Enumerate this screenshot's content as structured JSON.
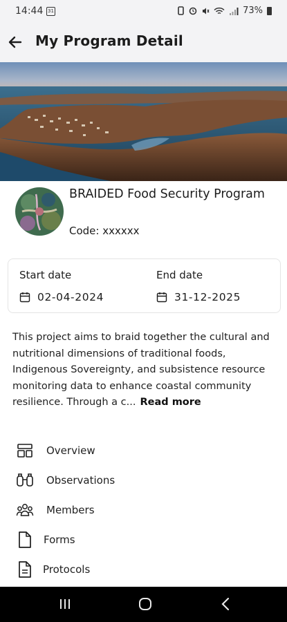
{
  "status": {
    "time": "14:44",
    "calendar_badge": "31",
    "battery": "73%"
  },
  "header": {
    "title": "My Program Detail",
    "back_icon": "arrow-left-icon"
  },
  "program": {
    "name": "BRAIDED Food Security Program",
    "code_label": "Code: xxxxxx"
  },
  "dates": {
    "start_label": "Start date",
    "start_value": "02-04-2024",
    "end_label": "End date",
    "end_value": "31-12-2025",
    "icon": "calendar-icon"
  },
  "description": {
    "text": "This project aims to braid together the cultural and nutritional dimensions of traditional foods, Indigenous Sovereignty, and subsistence resource monitoring data to enhance coastal community resilience. Through a c...",
    "read_more": "Read more"
  },
  "menu": {
    "items": [
      {
        "label": "Overview",
        "icon": "overview-icon"
      },
      {
        "label": "Observations",
        "icon": "binoculars-icon"
      },
      {
        "label": "Members",
        "icon": "members-icon"
      },
      {
        "label": "Forms",
        "icon": "form-icon"
      },
      {
        "label": "Protocols",
        "icon": "document-icon"
      }
    ]
  },
  "colors": {
    "app_bar_bg": "#f3f3f5",
    "text": "#1c1c1c",
    "nav_bar_bg": "#000000"
  }
}
